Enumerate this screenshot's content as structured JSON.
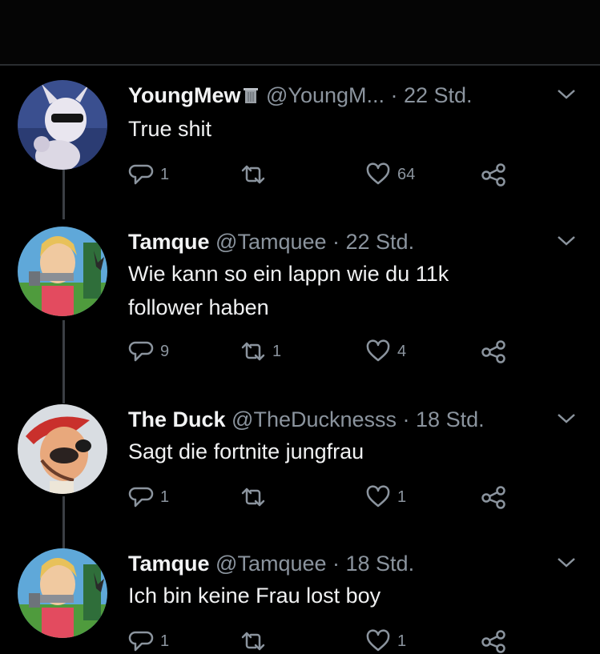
{
  "tweets": [
    {
      "name": "YoungMew",
      "handle": "@YoungM...",
      "sep": " · ",
      "time": "22 Std.",
      "text_lines": [
        "True shit"
      ],
      "reply_count": "1",
      "retweet_count": "",
      "like_count": "64"
    },
    {
      "name": "Tamque",
      "handle": "@Tamquee",
      "sep": " · ",
      "time": "22 Std.",
      "text_lines": [
        "Wie kann so ein lappn wie du 11k",
        "follower haben"
      ],
      "reply_count": "9",
      "retweet_count": "1",
      "like_count": "4"
    },
    {
      "name": "The Duck",
      "handle": "@TheDucknesss",
      "sep": " · ",
      "time": "18 Std.",
      "text_lines": [
        "Sagt die fortnite jungfrau"
      ],
      "reply_count": "1",
      "retweet_count": "",
      "like_count": "1"
    },
    {
      "name": "Tamque",
      "handle": "@Tamquee",
      "sep": " · ",
      "time": "18 Std.",
      "text_lines": [
        "Ich bin keine Frau lost boy"
      ],
      "reply_count": "1",
      "retweet_count": "",
      "like_count": "1"
    }
  ],
  "colors": {
    "background": "#000000",
    "text": "#e7e9ea",
    "muted": "#8b949e",
    "thread_line": "#3b3f44"
  },
  "icons": [
    "reply-icon",
    "retweet-icon",
    "like-icon",
    "share-icon",
    "chevron-down-icon",
    "trash-can-emoji-icon"
  ]
}
